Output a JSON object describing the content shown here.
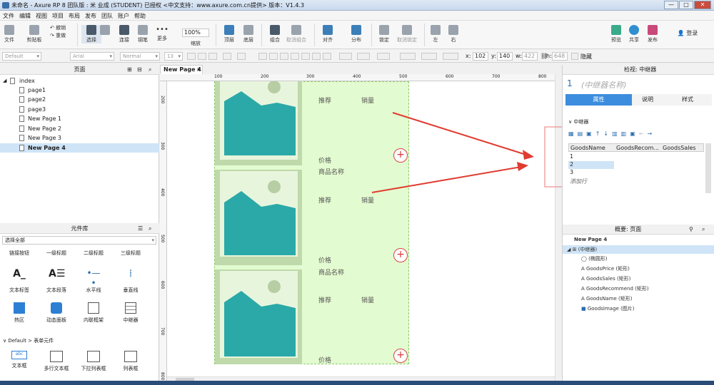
{
  "window": {
    "title": "未命名 - Axure RP 8 团队版 : 米 业成 (STUDENT) 已授权    <中文支持：www.axure.com.cn提供> 版本：V1.4.3",
    "controls": [
      "—",
      "□",
      "✕"
    ]
  },
  "menu": [
    "文件",
    "编辑",
    "视图",
    "项目",
    "布局",
    "发布",
    "团队",
    "账户",
    "帮助"
  ],
  "toolbar": {
    "file": "文件",
    "clipboard": "剪贴板",
    "undo": "撤销",
    "redo": "重做",
    "select": "选择",
    "connect": "连接",
    "pen": "钢笔",
    "more": "更多",
    "zoom": "100%",
    "zoom_label": "缩放",
    "top": "顶层",
    "bottom": "底层",
    "group": "组合",
    "ungroup": "取消组合",
    "align": "对齐",
    "distribute": "分布",
    "lock": "锁定",
    "unlock": "取消锁定",
    "left": "左",
    "right": "右",
    "preview": "预览",
    "share": "共享",
    "publish": "发布",
    "login": "登录"
  },
  "stylebar": {
    "style": "Default",
    "font": "Arial",
    "weight": "Normal",
    "size": "13",
    "x_label": "x:",
    "x": "102",
    "y_label": "y:",
    "y": "140",
    "w_label": "w:",
    "w": "422",
    "h_label": "h:",
    "h": "648",
    "hidden": "隐藏"
  },
  "pages_panel": {
    "title": "页面",
    "items": [
      "index",
      "page1",
      "page2",
      "page3",
      "New Page 1",
      "New Page 2",
      "New Page 3",
      "New Page 4"
    ],
    "selected": "New Page 4"
  },
  "library_panel": {
    "title": "元件库",
    "filter": "选择全部",
    "row1": [
      "链接按钮",
      "一级标题",
      "二级标题",
      "三级标题"
    ],
    "row2": [
      "文本标签",
      "文本段落",
      "水平线",
      "垂直线"
    ],
    "row3": [
      "热区",
      "动态面板",
      "内联框架",
      "中继器"
    ],
    "section": "Default > 表单元件",
    "row4": [
      "文本框",
      "多行文本框",
      "下拉列表框",
      "列表框"
    ]
  },
  "canvas": {
    "tab": "New Page 4",
    "ruler_h": [
      "100",
      "200",
      "300",
      "400",
      "500",
      "600",
      "700",
      "800"
    ],
    "ruler_v": [
      "200",
      "300",
      "400",
      "500",
      "600",
      "700",
      "800"
    ],
    "items": [
      {
        "recommend": "推荐",
        "sales": "销量",
        "price": "价格",
        "name": "商品名称"
      },
      {
        "recommend": "推荐",
        "sales": "销量",
        "price": "价格",
        "name": "商品名称"
      },
      {
        "recommend": "推荐",
        "sales": "销量",
        "price": "价格",
        "name": ""
      }
    ],
    "plus": "+"
  },
  "inspector": {
    "title": "检视: 中继器",
    "index": "1",
    "name_placeholder": "(中继器名称)",
    "tabs": [
      "属性",
      "说明",
      "样式"
    ],
    "section": "中继器",
    "columns": [
      "GoodsName",
      "GoodsRecom...",
      "GoodsSales"
    ],
    "rows": [
      "1",
      "2",
      "3"
    ],
    "add_row": "添加行"
  },
  "outline": {
    "title": "概要: 页面",
    "page": "New Page 4",
    "repeater": "(中继器)",
    "items": [
      "(椭圆形)",
      "GoodsPrice (矩形)",
      "GoodsSales (矩形)",
      "GoodsRecommend (矩形)",
      "GoodsName (矩形)",
      "GoodsImage (图片)"
    ]
  },
  "colors": {
    "accent": "#3c8dde",
    "repeater_bg": "#e3fbd0",
    "item_bg": "#bfd9aa",
    "image_teal": "#2aa9a8",
    "arrow_red": "#e03c31"
  }
}
